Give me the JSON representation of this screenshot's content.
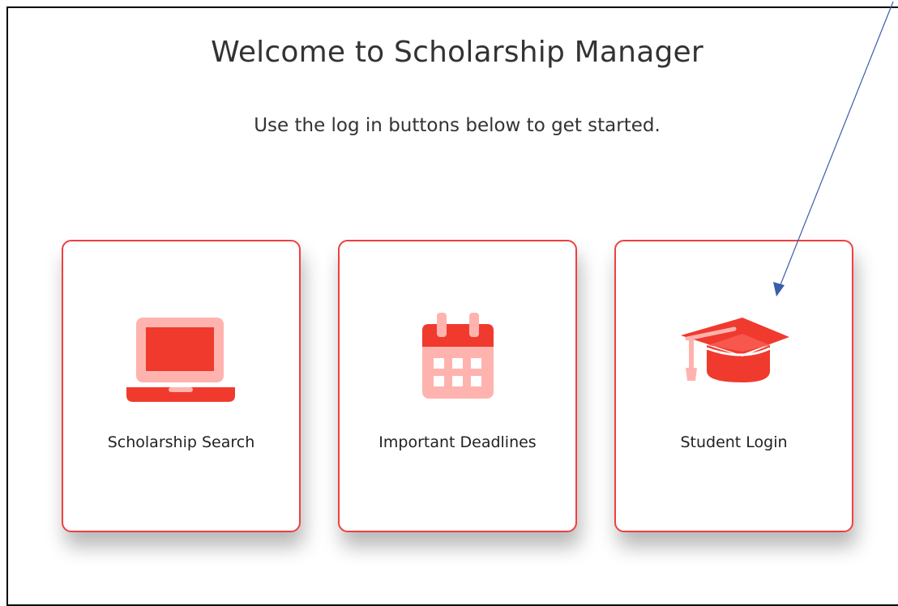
{
  "header": {
    "title": "Welcome to Scholarship Manager",
    "subtitle": "Use the log in buttons below to get started."
  },
  "cards": [
    {
      "label": "Scholarship Search",
      "icon": "laptop-icon"
    },
    {
      "label": "Important Deadlines",
      "icon": "calendar-icon"
    },
    {
      "label": "Student Login",
      "icon": "graduation-cap-icon"
    }
  ],
  "colors": {
    "accent": "#f03a2e",
    "accent_light": "#ffb3ae",
    "card_border": "#ee4040",
    "annotation_arrow": "#3a5ea8"
  }
}
